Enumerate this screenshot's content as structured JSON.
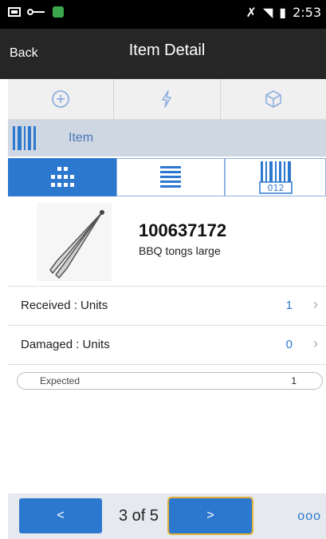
{
  "status_bar": {
    "time": "2:53"
  },
  "header": {
    "back_label": "Back",
    "title": "Item Detail"
  },
  "toolbar": {
    "icons": [
      "add-circle-icon",
      "lightning-icon",
      "cube-icon"
    ]
  },
  "section": {
    "label": "Item"
  },
  "view_tabs": {
    "barcode_tab_text": "012"
  },
  "item": {
    "id": "100637172",
    "description": "BBQ tongs large"
  },
  "rows": [
    {
      "label": "Received : Units",
      "value": "1"
    },
    {
      "label": "Damaged : Units",
      "value": "0"
    }
  ],
  "expected": {
    "label": "Expected",
    "value": "1"
  },
  "footer": {
    "prev_label": "<",
    "page_indicator": "3 of 5",
    "next_label": ">",
    "more_label": "ooo"
  },
  "colors": {
    "accent": "#2d78cf",
    "header_bg": "#262626",
    "section_bg": "#cfd7e2"
  }
}
